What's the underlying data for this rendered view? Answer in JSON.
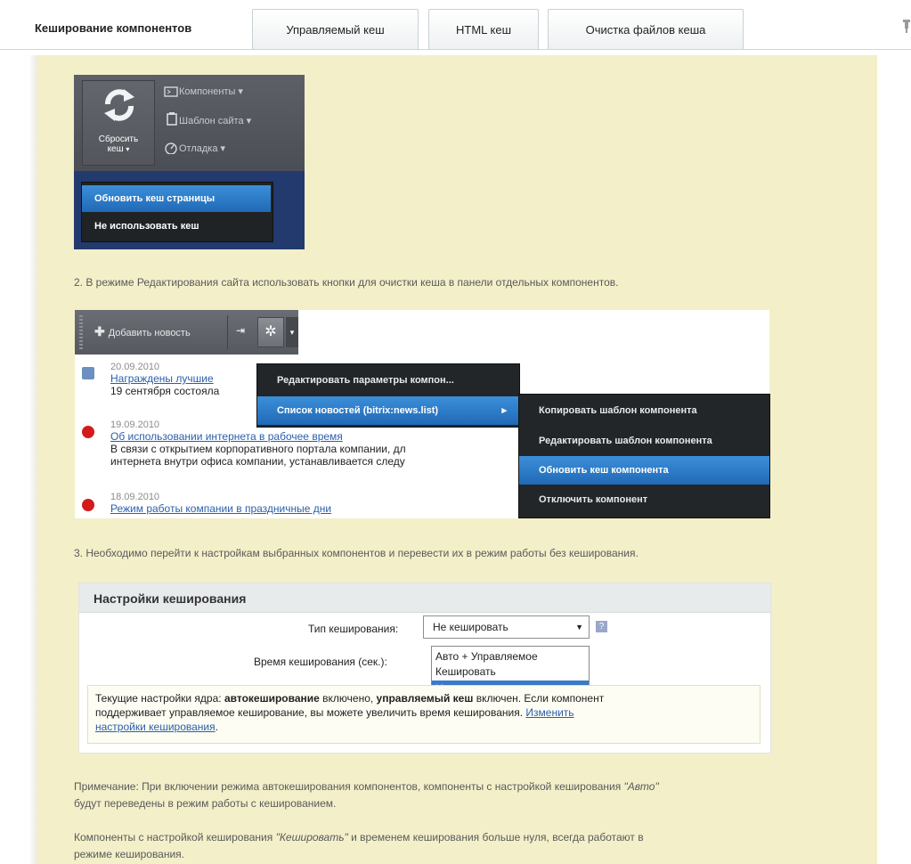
{
  "tabs": [
    {
      "label": "Кеширование компонентов",
      "active": true
    },
    {
      "label": "Управляемый кеш"
    },
    {
      "label": "HTML кеш"
    },
    {
      "label": "Очистка файлов кеша"
    }
  ],
  "panel1": {
    "reset_label_line1": "Сбросить",
    "reset_label_line2": "кеш",
    "menu_items": [
      "Компоненты",
      "Шаблон сайта",
      "Отладка"
    ],
    "dropdown": [
      "Обновить кеш страницы",
      "Не использовать кеш"
    ]
  },
  "step2": "2. В режиме Редактирования сайта использовать кнопки для очистки кеша в панели отдельных компонентов.",
  "panel2": {
    "add_news": "Добавить новость",
    "news": [
      {
        "date": "20.09.2010",
        "title": "Награждены лучшие",
        "text1": "19 сентября состояла"
      },
      {
        "date": "19.09.2010",
        "title": "Об использовании интернета в рабочее время",
        "text1": "В связи с открытием корпоративного портала компании, дл",
        "text2": "интернета внутри офиса компании, устанавливается следу"
      },
      {
        "date": "18.09.2010",
        "title": "Режим работы компании в праздничные дни"
      }
    ],
    "menu": [
      "Редактировать параметры компон...",
      "Список новостей (bitrix:news.list)"
    ],
    "submenu": [
      "Копировать шаблон компонента",
      "Редактировать шаблон компонента",
      "Обновить кеш компонента",
      "Отключить компонент"
    ]
  },
  "step3": "3. Необходимо перейти к настройкам выбранных компонентов и перевести их в режим работы без кеширования.",
  "settings": {
    "title": "Настройки кеширования",
    "cache_type_label": "Тип кеширования:",
    "cache_type_value": "Не кешировать",
    "cache_time_label": "Время кеширования (сек.):",
    "options": [
      "Авто + Управляемое",
      "Кешировать",
      "Не кешировать"
    ],
    "note_part1": "Текущие настройки ядра: ",
    "note_bold1": "автокеширование",
    "note_part2": " включено, ",
    "note_bold2": "управляемый кеш",
    "note_part3": " включен. Если компонент",
    "note_line2": "поддерживает управляемое кеширование, вы можете увеличить время кеширования. ",
    "note_link1": "Изменить",
    "note_link2": "настройки кеширования",
    "note_end": "."
  },
  "footer": {
    "note1_a": "Примечание: При включении режима автокеширования компонентов, компоненты с настройкой кеширования ",
    "note1_i": "\"Авто\"",
    "note1_b": "будут переведены в режим работы с кешированием.",
    "note2_a": "Компоненты с настройкой кеширования ",
    "note2_i": "\"Кешировать\"",
    "note2_b": " и временем кеширования больше нуля, всегда работают в",
    "note2_c": "режиме кеширования."
  }
}
